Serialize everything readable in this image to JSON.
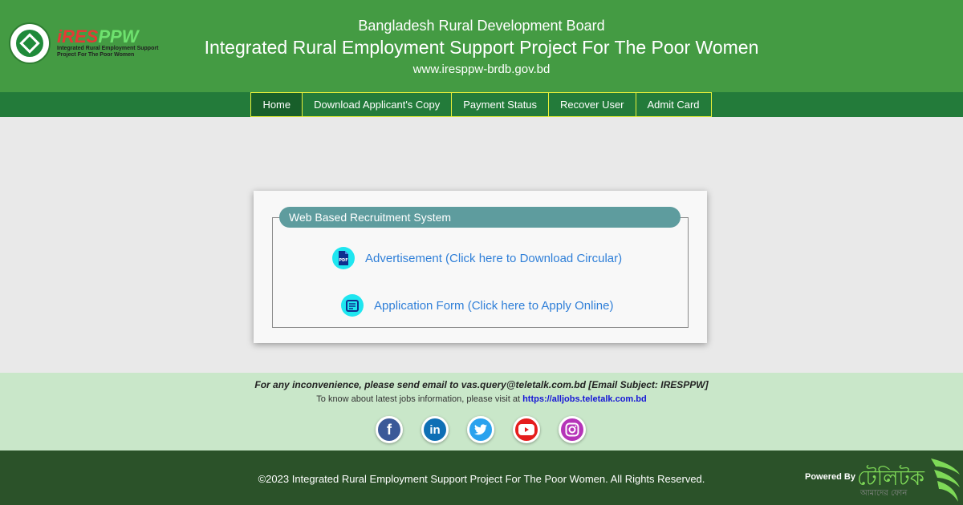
{
  "header": {
    "logo": {
      "brand_part1": "iRES",
      "brand_part2": "PPW",
      "sub_line1": "Integrated Rural Employment Support",
      "sub_line2": "Project For The Poor Women"
    },
    "org": "Bangladesh Rural Development Board",
    "title": "Integrated Rural Employment Support Project For The Poor Women",
    "url": "www.iresppw-brdb.gov.bd"
  },
  "nav": {
    "items": [
      {
        "label": "Home",
        "active": true
      },
      {
        "label": "Download Applicant's Copy",
        "active": false
      },
      {
        "label": "Payment Status",
        "active": false
      },
      {
        "label": "Recover User",
        "active": false
      },
      {
        "label": "Admit Card",
        "active": false
      }
    ]
  },
  "panel": {
    "legend": "Web Based Recruitment System",
    "links": [
      {
        "icon": "pdf-icon",
        "label": "Advertisement (Click here to Download Circular)"
      },
      {
        "icon": "form-icon",
        "label": "Application Form (Click here to Apply Online)"
      }
    ]
  },
  "footer": {
    "email_notice": "For any inconvenience, please send email to vas.query@teletalk.com.bd [Email Subject: IRESPPW]",
    "jobs_prefix": "To know about latest jobs information, please visit at",
    "jobs_link": "https://alljobs.teletalk.com.bd",
    "socials": [
      {
        "name": "facebook",
        "glyph": "f"
      },
      {
        "name": "linkedin",
        "glyph": "in"
      },
      {
        "name": "twitter",
        "glyph": "🐦"
      },
      {
        "name": "youtube",
        "glyph": "▶"
      },
      {
        "name": "instagram",
        "glyph": "◎"
      }
    ],
    "copyright": "©2023 Integrated Rural Employment Support Project For The Poor Women. All Rights Reserved.",
    "powered_by": "Powered By",
    "teletalk_word": "টেলিটক",
    "teletalk_tag": "আমাদের ফোন"
  },
  "colors": {
    "header_green": "#449b43",
    "nav_green": "#237b3a",
    "nav_border": "#e9f03a",
    "legend_teal": "#5e9c9e",
    "link_blue": "#2f7fd8",
    "footer_light": "#c9e7c9",
    "footer_dark": "#2b5229"
  }
}
